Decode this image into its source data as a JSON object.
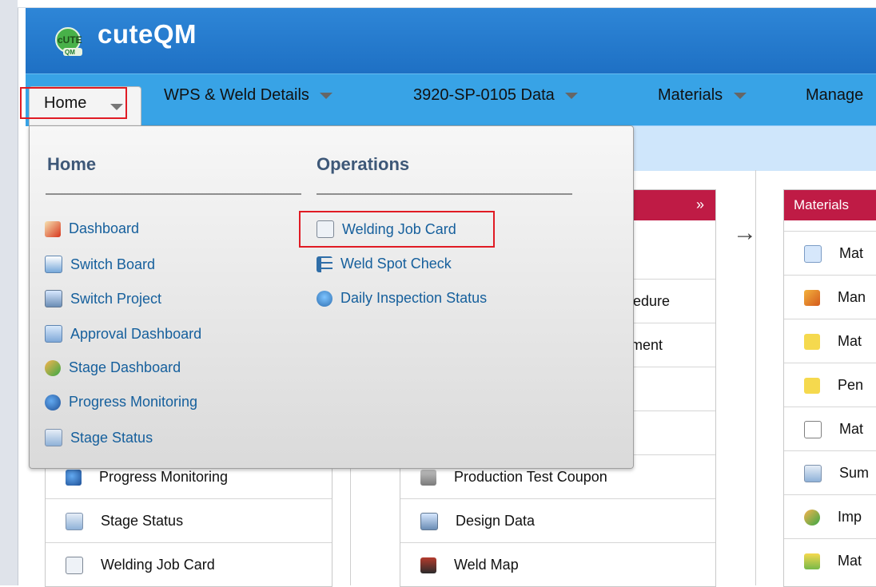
{
  "app": {
    "title": "cuteQM",
    "logo_text": "cUTE QM"
  },
  "nav": {
    "home": "Home",
    "items": [
      "WPS & Weld Details",
      "3920-SP-0105 Data",
      "Materials",
      "Manage"
    ]
  },
  "dropdown": {
    "home_heading": "Home",
    "operations_heading": "Operations",
    "home_items": [
      "Dashboard",
      "Switch Board",
      "Switch Project",
      "Approval Dashboard",
      "Stage Dashboard",
      "Progress Monitoring",
      "Stage Status"
    ],
    "operations_items": [
      "Welding Job Card",
      "Weld Spot Check",
      "Daily Inspection Status"
    ]
  },
  "left_panel": {
    "rows": [
      "Progress Monitoring",
      "Stage Status",
      "Welding Job Card"
    ]
  },
  "middle_panel": {
    "header": "",
    "header_icon": "chevron-up-icon",
    "partial_rows": [
      "ocedure",
      "rement"
    ],
    "rows": [
      "Production Test Coupon",
      "Design Data",
      "Weld Map"
    ]
  },
  "materials_panel": {
    "header": "Materials",
    "rows": [
      "Mat",
      "Man",
      "Mat",
      "Pen",
      "Mat",
      "Sum",
      "Imp",
      "Mat"
    ]
  },
  "colors": {
    "header_blue": "#1e70c4",
    "nav_blue": "#38a3e6",
    "panel_red": "#bf1b45",
    "link_blue": "#155f9c",
    "highlight_red": "#e01b24"
  }
}
